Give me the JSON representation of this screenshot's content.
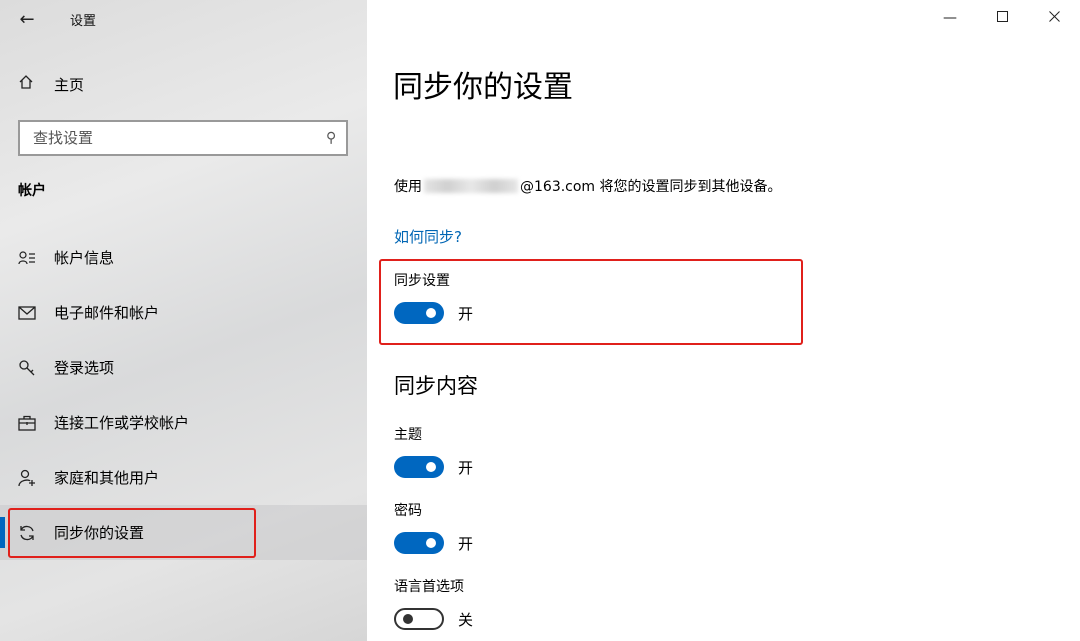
{
  "window": {
    "title": "设置"
  },
  "sidebar": {
    "home_label": "主页",
    "search_placeholder": "查找设置",
    "section_title": "帐户",
    "items": [
      {
        "label": "帐户信息",
        "icon": "person-list-icon"
      },
      {
        "label": "电子邮件和帐户",
        "icon": "mail-icon"
      },
      {
        "label": "登录选项",
        "icon": "key-icon"
      },
      {
        "label": "连接工作或学校帐户",
        "icon": "briefcase-icon"
      },
      {
        "label": "家庭和其他用户",
        "icon": "person-add-icon"
      },
      {
        "label": "同步你的设置",
        "icon": "sync-icon",
        "active": true
      }
    ]
  },
  "main": {
    "title": "同步你的设置",
    "desc_prefix": "使用",
    "desc_suffix": "@163.com 将您的设置同步到其他设备。",
    "how_link": "如何同步?",
    "sync_settings": {
      "label": "同步设置",
      "state": "开",
      "on": true
    },
    "sync_content_title": "同步内容",
    "options": [
      {
        "label": "主题",
        "state": "开",
        "on": true
      },
      {
        "label": "密码",
        "state": "开",
        "on": true
      },
      {
        "label": "语言首选项",
        "state": "关",
        "on": false
      }
    ]
  },
  "colors": {
    "accent": "#0067c0",
    "highlight": "#e0201b",
    "link": "#0066b4"
  }
}
